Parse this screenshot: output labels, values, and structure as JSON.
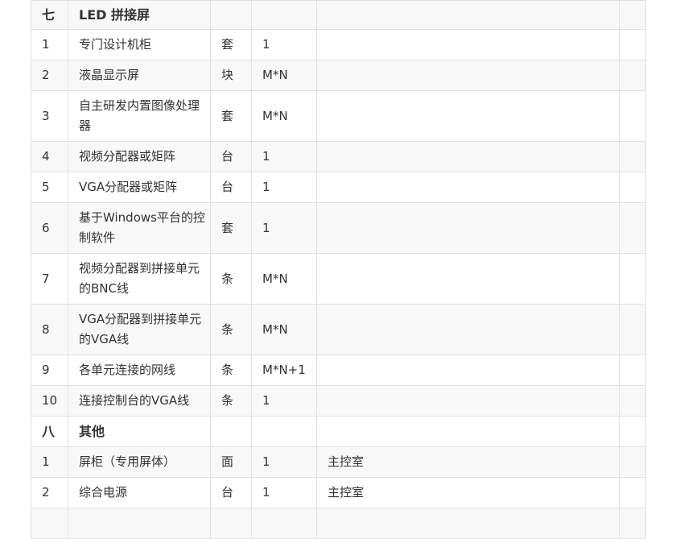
{
  "rows": [
    {
      "kind": "section",
      "no": "七",
      "name": "LED 拼接屏",
      "unit": "",
      "qty": "",
      "note": "",
      "height": 36
    },
    {
      "kind": "item",
      "no": "1",
      "name": "专门设计机柜",
      "unit": "套",
      "qty": "1",
      "note": "",
      "height": 38
    },
    {
      "kind": "item",
      "no": "2",
      "name": "液晶显示屏",
      "unit": "块",
      "qty": "M*N",
      "note": "",
      "height": 38
    },
    {
      "kind": "item",
      "no": "3",
      "name": "自主研发内置图像处理器",
      "unit": "套",
      "qty": "M*N",
      "note": "",
      "height": 63
    },
    {
      "kind": "item",
      "no": "4",
      "name": "视频分配器或矩阵",
      "unit": "台",
      "qty": "1",
      "note": "",
      "height": 38
    },
    {
      "kind": "item",
      "no": "5",
      "name": "VGA分配器或矩阵",
      "unit": "台",
      "qty": "1",
      "note": "",
      "height": 38
    },
    {
      "kind": "item",
      "no": "6",
      "name": "基于Windows平台的控制软件",
      "unit": "套",
      "qty": "1",
      "note": "",
      "height": 63
    },
    {
      "kind": "item",
      "no": "7",
      "name": "视频分配器到拼接单元的BNC线",
      "unit": "条",
      "qty": "M*N",
      "note": "",
      "height": 63
    },
    {
      "kind": "item",
      "no": "8",
      "name": "VGA分配器到拼接单元的VGA线",
      "unit": "条",
      "qty": "M*N",
      "note": "",
      "height": 63
    },
    {
      "kind": "item",
      "no": "9",
      "name": "各单元连接的网线",
      "unit": "条",
      "qty": "M*N+1",
      "note": "",
      "height": 38
    },
    {
      "kind": "item",
      "no": "10",
      "name": "连接控制台的VGA线",
      "unit": "条",
      "qty": "1",
      "note": "",
      "height": 38
    },
    {
      "kind": "section",
      "no": "八",
      "name": "其他",
      "unit": "",
      "qty": "",
      "note": "",
      "height": 38
    },
    {
      "kind": "item",
      "no": "1",
      "name": "屏柜（专用屏体）",
      "unit": "面",
      "qty": "1",
      "note": "主控室",
      "height": 38
    },
    {
      "kind": "item",
      "no": "2",
      "name": "综合电源",
      "unit": "台",
      "qty": "1",
      "note": "主控室",
      "height": 38
    },
    {
      "kind": "item",
      "no": "",
      "name": "",
      "unit": "",
      "qty": "",
      "note": "",
      "height": 38
    }
  ]
}
